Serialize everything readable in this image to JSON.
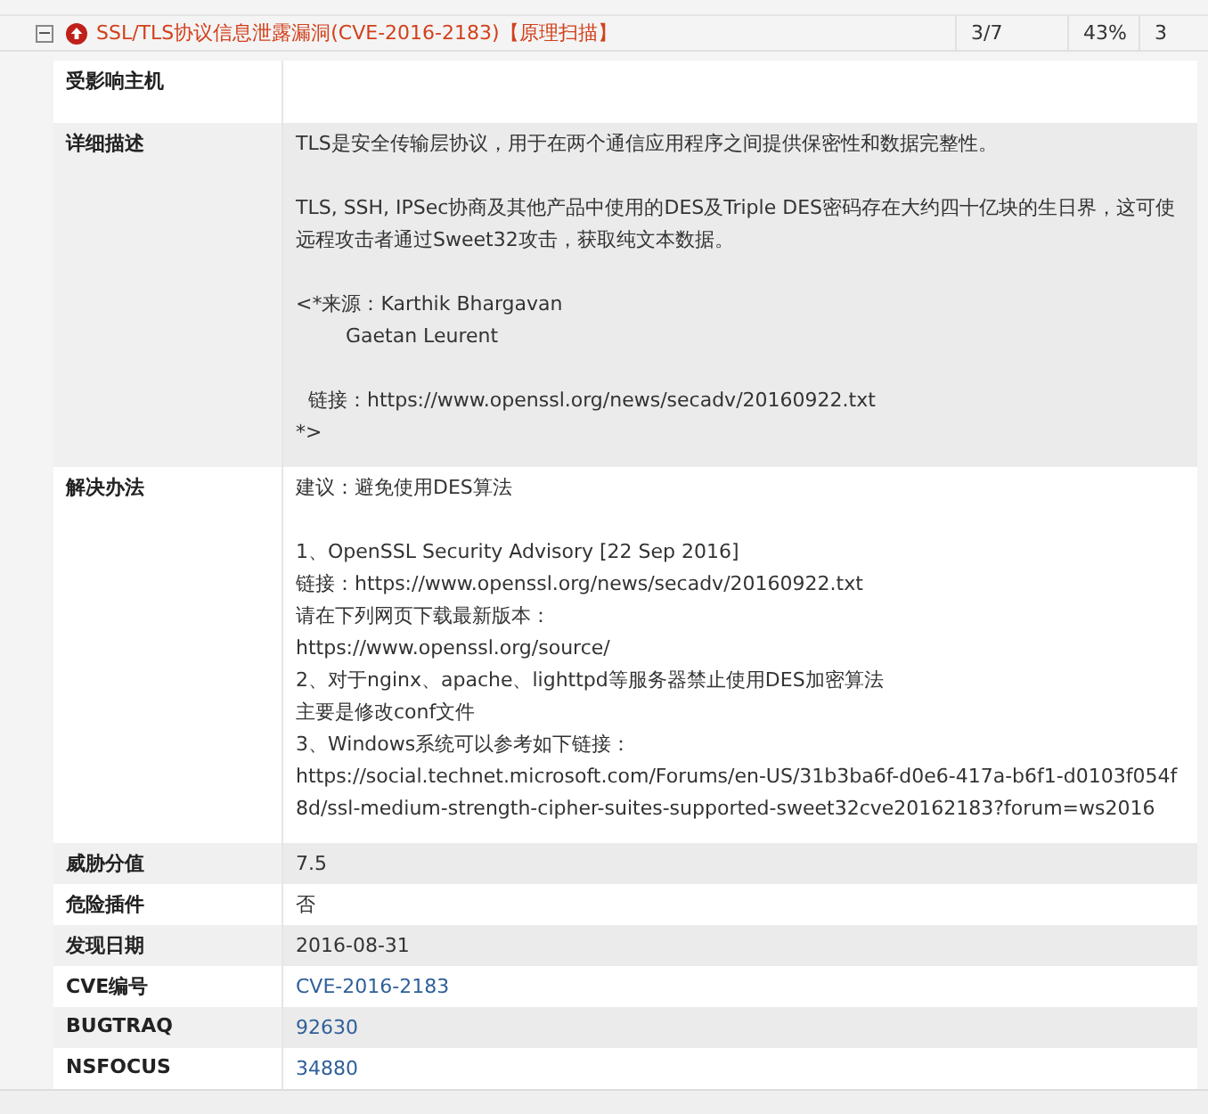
{
  "vulnerability": {
    "expanded": true,
    "title": "SSL/TLS协议信息泄露漏洞(CVE-2016-2183)【原理扫描】",
    "cells": [
      "3/7",
      "43%",
      "3"
    ]
  },
  "details": [
    {
      "label": "受影响主机"
    },
    {
      "label": "详细描述",
      "kind": "text",
      "paragraphs": [
        [
          "TLS是安全传输层协议，用于在两个通信应用程序之间提供保密性和数据完整性。"
        ],
        [
          "TLS, SSH, IPSec协商及其他产品中使用的DES及Triple DES密码存在大约四十亿块的生日界，这可使远程攻击者通过Sweet32攻击，获取纯文本数据。"
        ],
        [
          "<*来源：Karthik Bhargavan",
          "        Gaetan Leurent"
        ],
        [
          "  链接：https://www.openssl.org/news/secadv/20160922.txt",
          "*>"
        ]
      ]
    },
    {
      "label": "解决办法",
      "kind": "text",
      "paragraphs": [
        [
          "建议：避免使用DES算法"
        ],
        [
          "1、OpenSSL Security Advisory [22 Sep 2016]",
          "链接：https://www.openssl.org/news/secadv/20160922.txt",
          "请在下列网页下载最新版本：",
          "https://www.openssl.org/source/",
          "2、对于nginx、apache、lighttpd等服务器禁止使用DES加密算法",
          "主要是修改conf文件",
          "3、Windows系统可以参考如下链接：",
          "https://social.technet.microsoft.com/Forums/en-US/31b3ba6f-d0e6-417a-b6f1-d0103f054f8d/ssl-medium-strength-cipher-suites-supported-sweet32cve20162183?forum=ws2016"
        ]
      ]
    },
    {
      "label": "威胁分值",
      "kind": "text",
      "paragraphs": [
        [
          "7.5"
        ]
      ]
    },
    {
      "label": "危险插件",
      "kind": "text",
      "paragraphs": [
        [
          "否"
        ]
      ]
    },
    {
      "label": "发现日期",
      "kind": "text",
      "paragraphs": [
        [
          "2016-08-31"
        ]
      ]
    },
    {
      "label": "CVE编号",
      "kind": "link",
      "paragraphs": [
        [
          "CVE-2016-2183"
        ]
      ]
    },
    {
      "label": "BUGTRAQ",
      "kind": "link",
      "paragraphs": [
        [
          "92630"
        ]
      ]
    },
    {
      "label": "NSFOCUS",
      "kind": "link",
      "paragraphs": [
        [
          "34880"
        ]
      ]
    }
  ]
}
